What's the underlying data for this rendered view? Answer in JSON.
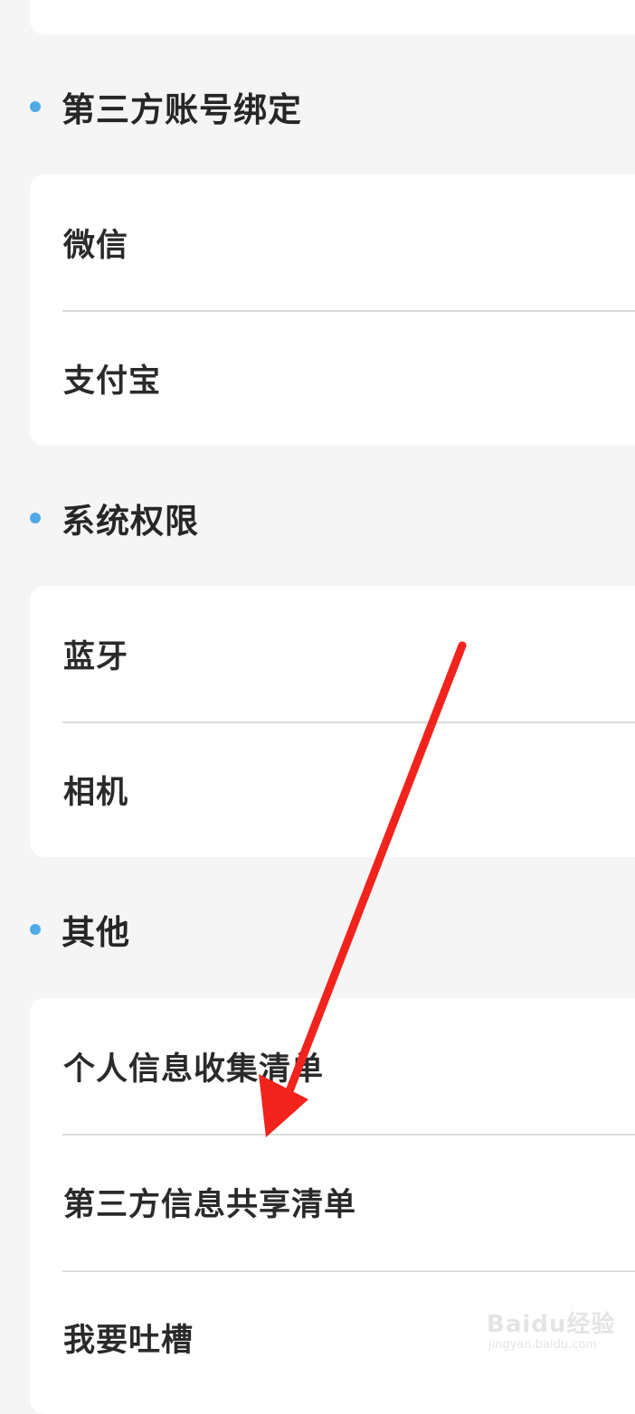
{
  "sections": [
    {
      "title": "第三方账号绑定",
      "items": [
        {
          "label": "微信"
        },
        {
          "label": "支付宝"
        }
      ]
    },
    {
      "title": "系统权限",
      "items": [
        {
          "label": "蓝牙"
        },
        {
          "label": "相机"
        }
      ]
    },
    {
      "title": "其他",
      "items": [
        {
          "label": "个人信息收集清单"
        },
        {
          "label": "第三方信息共享清单"
        },
        {
          "label": "我要吐槽"
        }
      ]
    }
  ],
  "watermark": {
    "main": "Baidu经验",
    "sub": "jingyan.baidu.com"
  },
  "colors": {
    "background": "#f5f5f5",
    "card": "#ffffff",
    "accent_dot": "#4ea9e6",
    "arrow": "#f2231d"
  }
}
